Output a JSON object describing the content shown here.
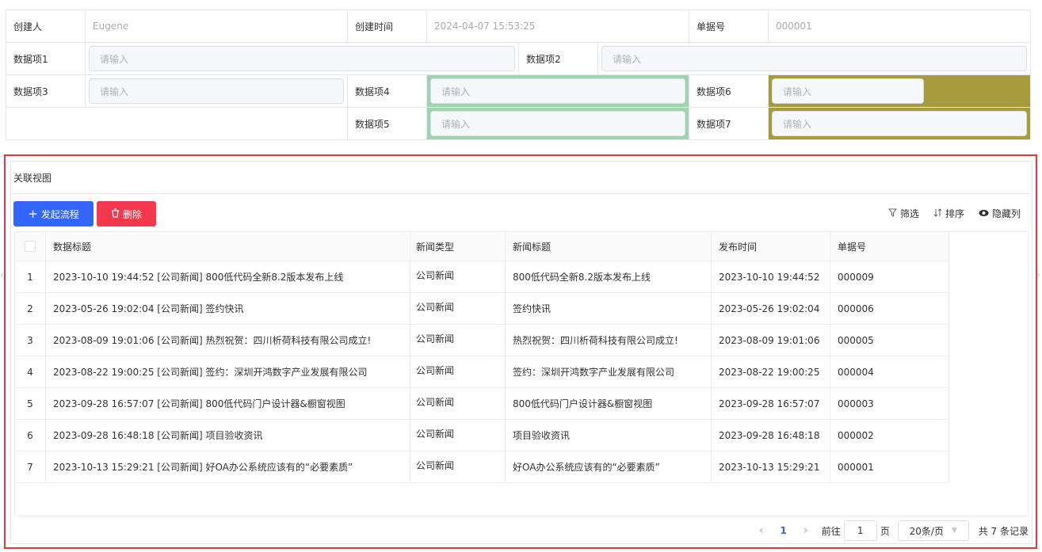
{
  "form": {
    "creator_label": "创建人",
    "creator_value": "Eugene",
    "created_time_label": "创建时间",
    "created_time_value": "2024-04-07 15:53:25",
    "doc_no_label": "单据号",
    "doc_no_value": "000001",
    "item1_label": "数据项1",
    "item2_label": "数据项2",
    "item3_label": "数据项3",
    "item4_label": "数据项4",
    "item5_label": "数据项5",
    "item6_label": "数据项6",
    "item7_label": "数据项7",
    "placeholder": "请输入",
    "colors": {
      "green": "#9fd5ac",
      "olive": "#a69a3c"
    }
  },
  "related": {
    "title": "关联视图",
    "start_flow_label": "发起流程",
    "delete_label": "删除",
    "filter_label": "筛选",
    "sort_label": "排序",
    "hide_cols_label": "隐藏列",
    "columns": [
      "数据标题",
      "新闻类型",
      "新闻标题",
      "发布时间",
      "单据号"
    ],
    "rows": [
      {
        "idx": "1",
        "title": "2023-10-10 19:44:52 [公司新闻] 800低代码全新8.2版本发布上线",
        "type": "公司新闻",
        "news": "800低代码全新8.2版本发布上线",
        "time": "2023-10-10 19:44:52",
        "no": "000009"
      },
      {
        "idx": "2",
        "title": "2023-05-26 19:02:04 [公司新闻] 签约快讯",
        "type": "公司新闻",
        "news": "签约快讯",
        "time": "2023-05-26 19:02:04",
        "no": "000006"
      },
      {
        "idx": "3",
        "title": "2023-08-09 19:01:06 [公司新闻] 热烈祝贺：四川析荷科技有限公司成立!",
        "type": "公司新闻",
        "news": "热烈祝贺：四川析荷科技有限公司成立!",
        "time": "2023-08-09 19:01:06",
        "no": "000005"
      },
      {
        "idx": "4",
        "title": "2023-08-22 19:00:25 [公司新闻] 签约：深圳开鸿数字产业发展有限公司",
        "type": "公司新闻",
        "news": "签约：深圳开鸿数字产业发展有限公司",
        "time": "2023-08-22 19:00:25",
        "no": "000004"
      },
      {
        "idx": "5",
        "title": "2023-09-28 16:57:07 [公司新闻] 800低代码门户设计器&橱窗视图",
        "type": "公司新闻",
        "news": "800低代码门户设计器&橱窗视图",
        "time": "2023-09-28 16:57:07",
        "no": "000003"
      },
      {
        "idx": "6",
        "title": "2023-09-28 16:48:18 [公司新闻] 项目验收资讯",
        "type": "公司新闻",
        "news": "项目验收资讯",
        "time": "2023-09-28 16:48:18",
        "no": "000002"
      },
      {
        "idx": "7",
        "title": "2023-10-13 15:29:21 [公司新闻] 好OA办公系统应该有的“必要素质”",
        "type": "公司新闻",
        "news": "好OA办公系统应该有的“必要素质”",
        "time": "2023-10-13 15:29:21",
        "no": "000001"
      }
    ],
    "pager": {
      "current_page": "1",
      "goto_label": "前往",
      "goto_value": "1",
      "page_unit": "页",
      "page_size": "20条/页",
      "total": "共 7 条记录"
    },
    "colors": {
      "primary": "#3366ff",
      "danger": "#f5384d",
      "highlight": "#e53935"
    }
  }
}
